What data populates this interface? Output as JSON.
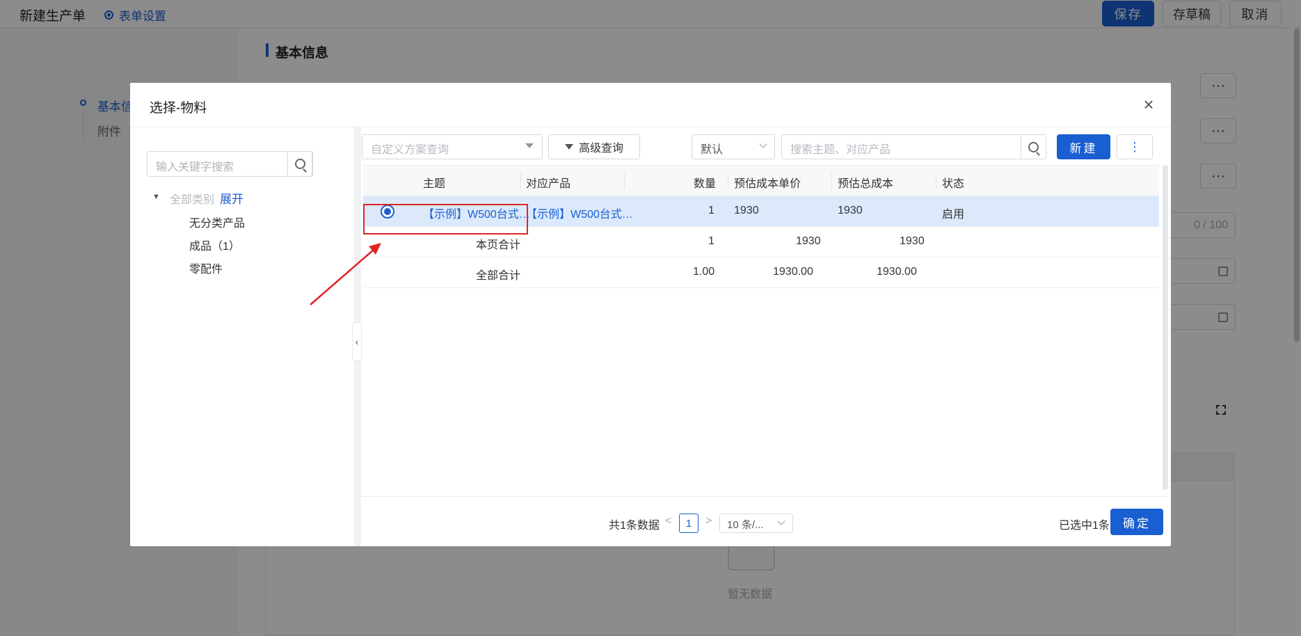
{
  "page": {
    "title": "新建生产单",
    "form_settings": "表单设置",
    "save": "保存",
    "draft": "存草稿",
    "cancel": "取消",
    "nav": [
      "基本信",
      "附件"
    ],
    "section_title": "基本信息",
    "more": "···",
    "char_count": "0 / 100",
    "empty_text": "暂无数据"
  },
  "modal": {
    "title": "选择-物料",
    "close": "×",
    "tree": {
      "search_placeholder": "输入关键字搜索",
      "root": "全部类别",
      "expand": "展开",
      "nodes": [
        "无分类产品",
        "成品（1）",
        "零配件"
      ]
    },
    "toolbar": {
      "scheme_placeholder": "自定义方案查询",
      "advanced": "高级查询",
      "default_sort": "默认",
      "search_placeholder": "搜索主题、对应产品",
      "new": "新建",
      "more": "⋮"
    },
    "table": {
      "headers": [
        "主题",
        "对应产品",
        "数量",
        "预估成本单价",
        "预估总成本",
        "状态"
      ],
      "rows": [
        {
          "subject": "【示例】W500台式…",
          "product": "【示例】W500台式…",
          "qty": "1",
          "unit_cost": "1930",
          "total_cost": "1930",
          "status": "启用"
        }
      ],
      "page_total": {
        "label": "本页合计",
        "qty": "1",
        "unit_cost": "1930",
        "total_cost": "1930"
      },
      "all_total": {
        "label": "全部合计",
        "qty": "1.00",
        "unit_cost": "1930.00",
        "total_cost": "1930.00"
      }
    },
    "pager": {
      "total": "共1条数据",
      "prev": "<",
      "page": "1",
      "next": ">",
      "page_size": "10 条/..."
    },
    "selected": "已选中1条",
    "confirm": "确定"
  },
  "colors": {
    "accent": "#1a5fd1",
    "annotation": "#e02525"
  }
}
